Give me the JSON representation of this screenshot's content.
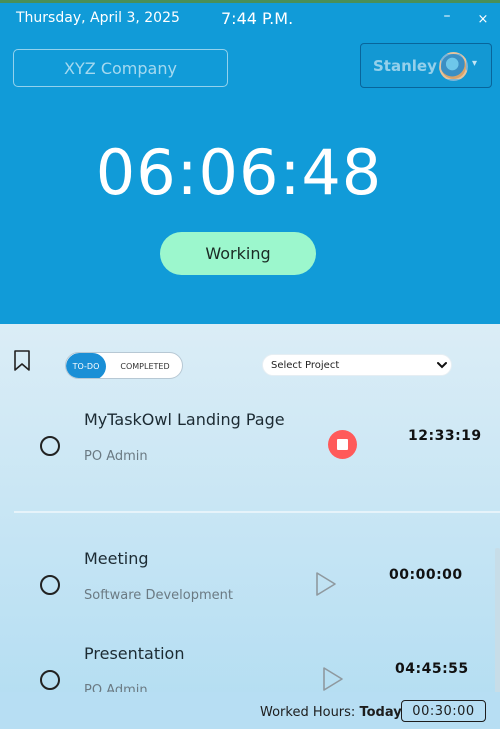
{
  "header": {
    "date": "Thursday, April 3, 2025",
    "time": "7:44 P.M.",
    "minimize": "–",
    "close": "×"
  },
  "company": {
    "label": "XYZ Company"
  },
  "user": {
    "name": "Stanley"
  },
  "timer": {
    "value": "06:06:48"
  },
  "status": {
    "label": "Working"
  },
  "tabs": {
    "todo": "TO-DO",
    "completed": "COMPLETED"
  },
  "project_select": {
    "placeholder": "Select Project"
  },
  "tasks": [
    {
      "title": "MyTaskOwl Landing Page",
      "project": "PO Admin",
      "duration": "12:33:19",
      "state": "running"
    },
    {
      "title": "Meeting",
      "project": "Software Development",
      "duration": "00:00:00",
      "state": "stopped"
    },
    {
      "title": "Presentation",
      "project": "PO Admin",
      "duration": "04:45:55",
      "state": "stopped"
    }
  ],
  "footer": {
    "label": "Worked Hours:",
    "period": "Today",
    "value": "00:30:00"
  },
  "colors": {
    "header_bg": "#119bd8",
    "status_btn": "#9cf7cd",
    "stop_btn": "#ff5a5a",
    "toggle_active": "#1a8fd6"
  },
  "icons": [
    "bookmark-icon",
    "stop-icon",
    "play-icon",
    "chevron-down-icon",
    "avatar"
  ]
}
